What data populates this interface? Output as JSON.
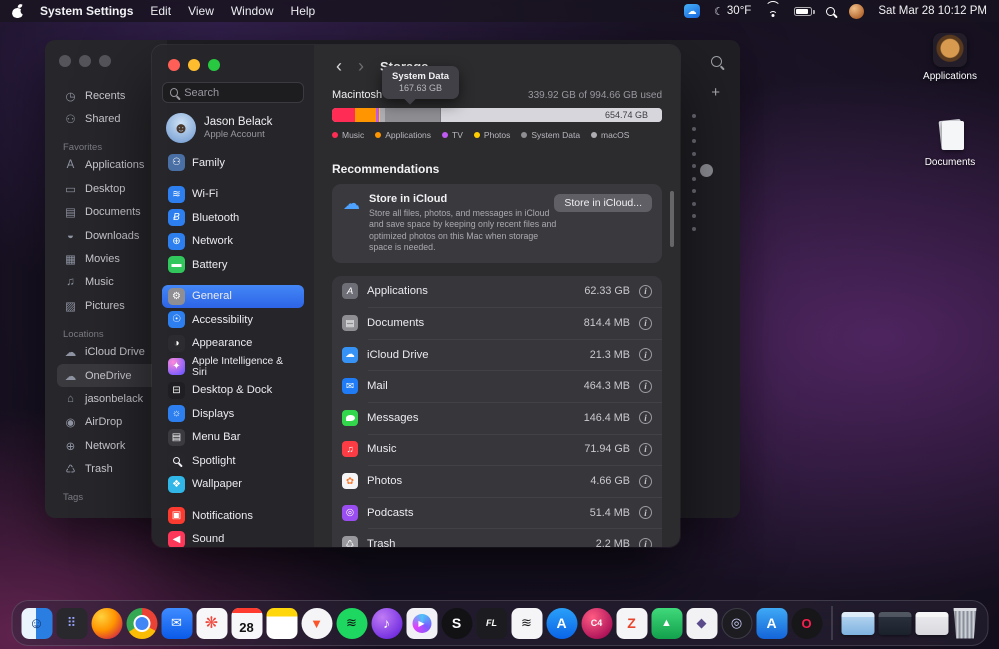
{
  "menu_bar": {
    "app_name": "System Settings",
    "menus": {
      "edit": "Edit",
      "view": "View",
      "window": "Window",
      "help": "Help"
    },
    "status": {
      "temperature": "30°F",
      "clock": "Sat Mar 28 10:12 PM"
    }
  },
  "finder": {
    "items": {
      "recents": "Recents",
      "shared": "Shared",
      "favorites_label": "Favorites",
      "applications": "Applications",
      "desktop": "Desktop",
      "documents": "Documents",
      "downloads": "Downloads",
      "movies": "Movies",
      "music": "Music",
      "pictures": "Pictures",
      "locations_label": "Locations",
      "icloud": "iCloud Drive",
      "onedrive": "OneDrive",
      "home": "jasonbelack",
      "airdrop": "AirDrop",
      "network": "Network",
      "trash": "Trash",
      "tags_label": "Tags"
    }
  },
  "settings": {
    "search_placeholder": "Search",
    "account": {
      "name": "Jason Belack",
      "subtitle": "Apple Account"
    },
    "items": {
      "family": "Family",
      "wifi": "Wi-Fi",
      "bluetooth": "Bluetooth",
      "network": "Network",
      "battery": "Battery",
      "general": "General",
      "accessibility": "Accessibility",
      "appearance": "Appearance",
      "ai_siri": "Apple Intelligence & Siri",
      "desktop_dock": "Desktop & Dock",
      "displays": "Displays",
      "menu_bar": "Menu Bar",
      "spotlight": "Spotlight",
      "wallpaper": "Wallpaper",
      "notifications": "Notifications",
      "sound": "Sound"
    },
    "selected_item": "General"
  },
  "storage": {
    "title": "Storage",
    "tooltip": {
      "title": "System Data",
      "value": "167.63 GB"
    },
    "volume_name": "Macintosh HD",
    "usage_summary": "339.92 GB of 994.66 GB used",
    "free_label": "654.74 GB",
    "legend": [
      "Music",
      "Applications",
      "TV",
      "Photos",
      "System Data",
      "macOS"
    ],
    "recommendations_title": "Recommendations",
    "icloud_card": {
      "title": "Store in iCloud",
      "description": "Store all files, photos, and messages in iCloud and save space by keeping only recent files and optimized photos on this Mac when storage space is needed.",
      "button_label": "Store in iCloud..."
    },
    "categories": [
      {
        "name": "Applications",
        "size": "62.33 GB"
      },
      {
        "name": "Documents",
        "size": "814.4 MB"
      },
      {
        "name": "iCloud Drive",
        "size": "21.3 MB"
      },
      {
        "name": "Mail",
        "size": "464.3 MB"
      },
      {
        "name": "Messages",
        "size": "146.4 MB"
      },
      {
        "name": "Music",
        "size": "71.94 GB"
      },
      {
        "name": "Photos",
        "size": "4.66 GB"
      },
      {
        "name": "Podcasts",
        "size": "51.4 MB"
      },
      {
        "name": "Trash",
        "size": "2.2 MB"
      }
    ]
  },
  "desktop": {
    "icons": [
      {
        "label": "Applications"
      },
      {
        "label": "Documents"
      }
    ]
  },
  "dock": {
    "calendar_day": "28",
    "apps": [
      {
        "name": "finder",
        "glyph": "☺"
      },
      {
        "name": "launchpad",
        "glyph": "⠿"
      },
      {
        "name": "firefox",
        "glyph": ""
      },
      {
        "name": "chrome",
        "glyph": ""
      },
      {
        "name": "mail",
        "glyph": "✉"
      },
      {
        "name": "photos",
        "glyph": "❋"
      },
      {
        "name": "calendar",
        "glyph": ""
      },
      {
        "name": "notes",
        "glyph": ""
      },
      {
        "name": "brave",
        "glyph": "▼"
      },
      {
        "name": "spotify",
        "glyph": "≋"
      },
      {
        "name": "music-purple",
        "glyph": "♪"
      },
      {
        "name": "iina",
        "glyph": "▶"
      },
      {
        "name": "s-app",
        "glyph": "S"
      },
      {
        "name": "fl-studio",
        "glyph": "FL"
      },
      {
        "name": "typing-app",
        "glyph": "≋"
      },
      {
        "name": "app-store",
        "glyph": "A"
      },
      {
        "name": "cinema4d",
        "glyph": "C4"
      },
      {
        "name": "zbrush",
        "glyph": "Z"
      },
      {
        "name": "green-app",
        "glyph": "▲"
      },
      {
        "name": "gem-app",
        "glyph": "◆"
      },
      {
        "name": "controller-app",
        "glyph": "◎"
      },
      {
        "name": "blue-a-app",
        "glyph": "A"
      },
      {
        "name": "opera-gx",
        "glyph": "O"
      }
    ]
  },
  "icons": {
    "back": "‹",
    "forward": "›",
    "plus": "+",
    "cloud": "☁",
    "moon": "☾",
    "info": "i",
    "finder": {
      "recents": "◷",
      "shared": "⚇",
      "applications": "A",
      "desktop": "▭",
      "documents": "▤",
      "downloads": "◒",
      "movies": "▦",
      "music": "♫",
      "pictures": "▨",
      "icloud": "☁",
      "onedrive": "☁",
      "home": "⌂",
      "airdrop": "◉",
      "network": "⊕",
      "trash": "♺"
    },
    "settings": {
      "family": "⚇",
      "wifi": "≋",
      "bluetooth": "Ƀ",
      "network": "⊕",
      "battery": "▬",
      "general": "⚙",
      "accessibility": "☉",
      "appearance": "◑",
      "ai_siri": "✦",
      "desktop_dock": "⊟",
      "displays": "☼",
      "menu_bar": "▤",
      "wallpaper": "❖",
      "notifications": "▣",
      "sound": "◀"
    },
    "categories": {
      "applications": "A",
      "documents": "▤",
      "icloud": "☁",
      "mail": "✉",
      "music": "♫",
      "photos": "✿",
      "podcasts": "◎",
      "trash": "♺"
    }
  },
  "colors": {
    "accent_blue": "#3478f6",
    "storage_music": "#ff2d55",
    "storage_applications": "#ff9500",
    "storage_tv": "#bf5af2",
    "storage_photos": "#ffcc00",
    "storage_system_data": "#8e8e93",
    "storage_macos": "#aeaeb2",
    "storage_free": "#d6d6dc"
  }
}
